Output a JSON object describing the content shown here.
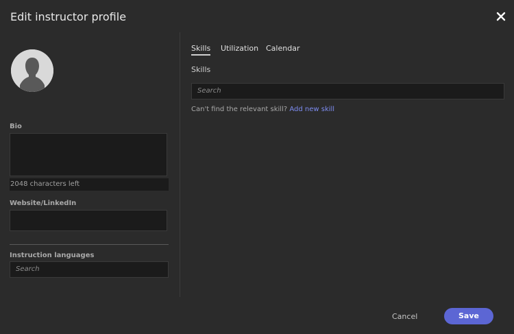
{
  "dialog": {
    "title": "Edit instructor profile"
  },
  "left_panel": {
    "bio_label": "Bio",
    "bio_value": "",
    "bio_counter": "2048 characters left",
    "website_label": "Website/LinkedIn",
    "website_value": "",
    "languages_label": "Instruction languages",
    "languages_placeholder": "Search"
  },
  "right_panel": {
    "tabs": [
      {
        "label": "Skills",
        "active": true
      },
      {
        "label": "Utilization",
        "active": false
      },
      {
        "label": "Calendar",
        "active": false
      }
    ],
    "skills_heading": "Skills",
    "skills_search_placeholder": "Search",
    "cant_find_text": "Can't find the relevant skill?",
    "add_skill_link": "Add new skill"
  },
  "footer": {
    "cancel_label": "Cancel",
    "save_label": "Save"
  },
  "colors": {
    "background": "#2b2b2b",
    "input_background": "#1b1b1b",
    "accent": "#5c66d4",
    "link": "#7d8cf0"
  },
  "icons": {
    "close": "close-icon",
    "avatar": "user-silhouette-icon"
  }
}
